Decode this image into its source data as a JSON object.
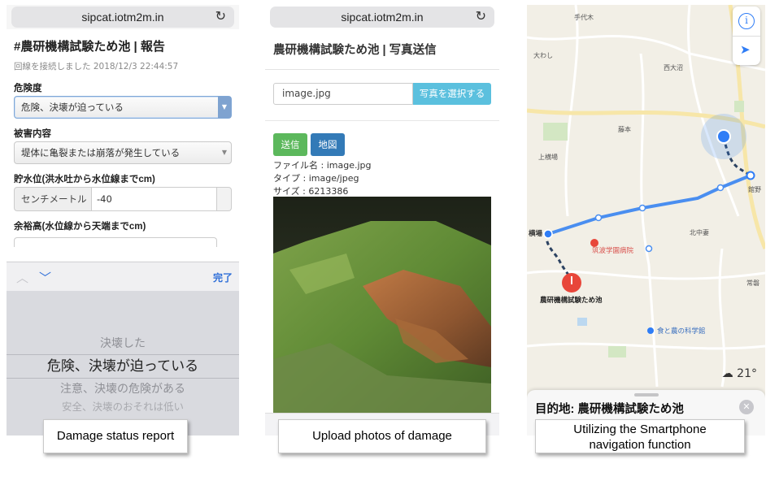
{
  "panel1": {
    "url": "sipcat.iotm2m.in",
    "title": "#農研機構試験ため池 | 報告",
    "status": "回線を接続しました 2018/12/3 22:44:57",
    "danger_label": "危険度",
    "danger_value": "危険、決壊が迫っている",
    "damage_label": "被害内容",
    "damage_value": "堤体に亀裂または崩落が発生している",
    "water_label": "貯水位(洪水吐から水位線までcm)",
    "water_unit": "センチメートル",
    "water_value": "-40",
    "freeboard_label": "余裕高(水位線から天端までcm)",
    "done_label": "完了",
    "picker_options": [
      "決壊した",
      "危険、決壊が迫っている",
      "注意、決壊の危険がある",
      "安全、決壊のおそれは低い"
    ],
    "caption": "Damage status report"
  },
  "panel2": {
    "url": "sipcat.iotm2m.in",
    "title": "農研機構試験ため池 | 写真送信",
    "file_value": "image.jpg",
    "choose_button": "写真を選択する",
    "send_button": "送信",
    "map_button": "地図",
    "file_name": "ファイル名 : image.jpg",
    "file_type": "タイプ : image/jpeg",
    "file_size": "サイズ : 6213386",
    "caption": "Upload photos of damage"
  },
  "panel3": {
    "labels": {
      "tezuka": "手代木",
      "owashi": "大わし",
      "nishiotani": "西大沼",
      "fujimoto": "藤本",
      "kamiyokoba": "上横場",
      "yokoba": "横場",
      "hospital": "筑波学園病院",
      "kitanaka": "北中妻",
      "ayano": "館野",
      "pond": "農研機構試験ため池",
      "foodmuseum": "食と農の科学館",
      "road": "常磐"
    },
    "weather": "21°",
    "destination": "目的地: 農研機構試験ため池",
    "caption_line1": "Utilizing the Smartphone",
    "caption_line2": "navigation function"
  },
  "colors": {
    "accent_blue": "#2f7df6",
    "btn_info": "#5bc0de",
    "btn_success": "#5cb85c",
    "btn_primary": "#337ab7",
    "pin_red": "#e8463a"
  },
  "icons": {
    "reload": "reload-icon",
    "info": "info-icon",
    "location": "location-arrow-icon",
    "close": "close-icon",
    "cloud": "cloud-icon"
  }
}
